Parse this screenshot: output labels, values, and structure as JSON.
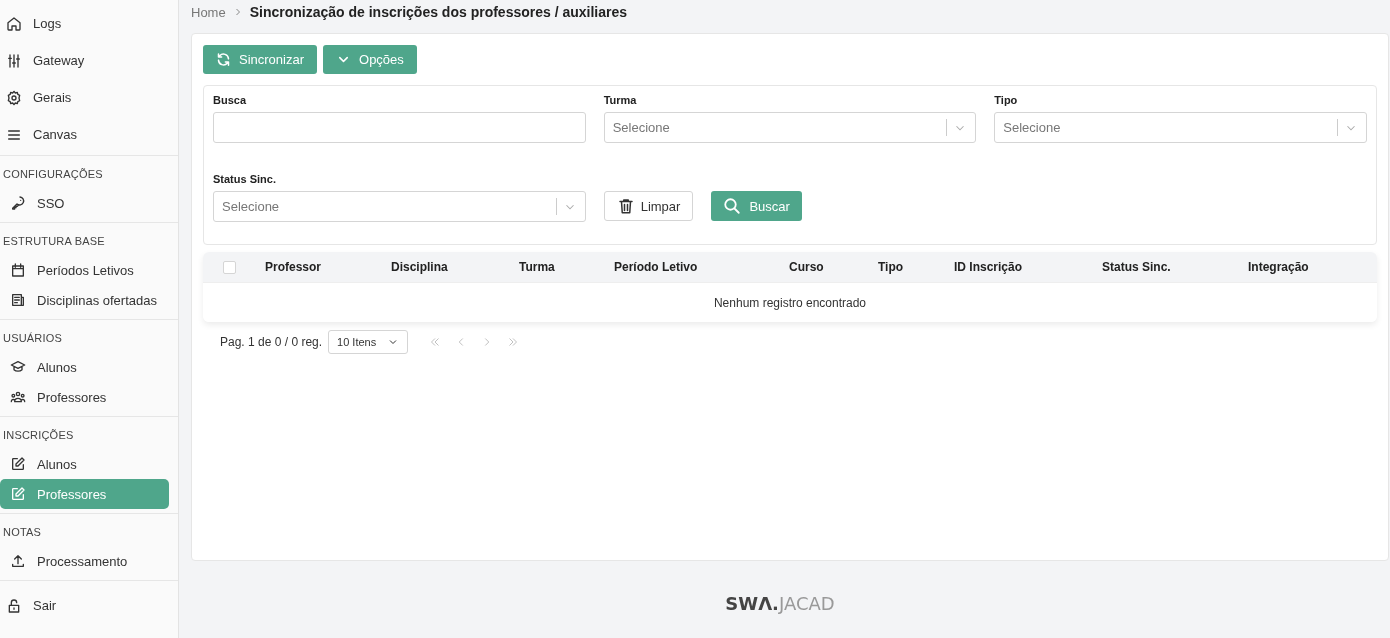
{
  "breadcrumb": {
    "home": "Home",
    "current": "Sincronização de inscrições dos professores / auxiliares"
  },
  "sidebar": {
    "sections": [
      {
        "items": [
          {
            "label": "Logs",
            "selected": false
          },
          {
            "label": "Gateway",
            "selected": false
          },
          {
            "label": "Gerais",
            "selected": false
          },
          {
            "label": "Canvas",
            "selected": false
          }
        ]
      },
      {
        "header": "CONFIGURAÇÕES",
        "items": [
          {
            "label": "SSO",
            "selected": false
          }
        ]
      },
      {
        "header": "ESTRUTURA BASE",
        "items": [
          {
            "label": "Períodos Letivos",
            "selected": false
          },
          {
            "label": "Disciplinas ofertadas",
            "selected": false
          }
        ]
      },
      {
        "header": "USUÁRIOS",
        "items": [
          {
            "label": "Alunos",
            "selected": false
          },
          {
            "label": "Professores",
            "selected": false
          }
        ]
      },
      {
        "header": "INSCRIÇÕES",
        "items": [
          {
            "label": "Alunos",
            "selected": false
          },
          {
            "label": "Professores",
            "selected": true
          }
        ]
      },
      {
        "header": "NOTAS",
        "items": [
          {
            "label": "Processamento",
            "selected": false
          }
        ]
      },
      {
        "items": [
          {
            "label": "Sair",
            "selected": false
          }
        ]
      }
    ]
  },
  "toolbar": {
    "buttons": [
      "Sincronizar",
      "Opções"
    ]
  },
  "filters": {
    "fields": [
      {
        "label": "Busca",
        "kind": "text"
      },
      {
        "label": "Turma",
        "kind": "select",
        "placeholder": "Selecione"
      },
      {
        "label": "Tipo",
        "kind": "select",
        "placeholder": "Selecione"
      },
      {
        "label": "Status Sinc.",
        "kind": "select",
        "placeholder": "Selecione"
      }
    ],
    "buttons": [
      {
        "label": "Limpar",
        "kind": "outline"
      },
      {
        "label": "Buscar",
        "kind": "primary"
      }
    ]
  },
  "table": {
    "select_all": {
      "checked": false
    },
    "columns": [
      "Professor",
      "Disciplina",
      "Turma",
      "Período Letivo",
      "Curso",
      "Tipo",
      "ID Inscrição",
      "Status Sinc.",
      "Integração"
    ],
    "empty_message": "Nenhum registro encontrado"
  },
  "pagination": {
    "summary": "Pag. 1 de 0 / 0 reg.",
    "page_size": "10 Itens"
  },
  "footer": {
    "logo_mark": "SWΛ.",
    "logo_text": "JACAD"
  }
}
